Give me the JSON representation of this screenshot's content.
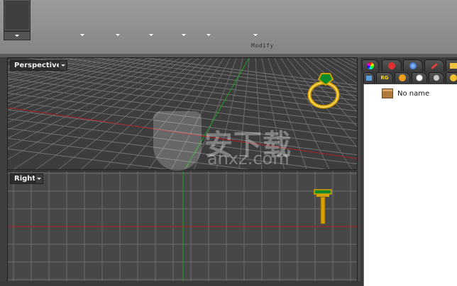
{
  "ribbon": {
    "group_label": "Modify",
    "dropdown_count": 7
  },
  "viewports": {
    "perspective": {
      "label": "Perspective"
    },
    "right": {
      "label": "Right"
    }
  },
  "panel": {
    "tree_items": [
      {
        "label": "No name"
      }
    ],
    "tab_row2_text": "RG"
  },
  "watermark": {
    "text": "安下载",
    "sub": "anxz.com"
  },
  "colors": {
    "grid_line": "#8a8a8a",
    "axis_x": "#b02020",
    "axis_y": "#20a020",
    "ring_gold": "#d8a000",
    "gem": "#0a8a2a"
  }
}
